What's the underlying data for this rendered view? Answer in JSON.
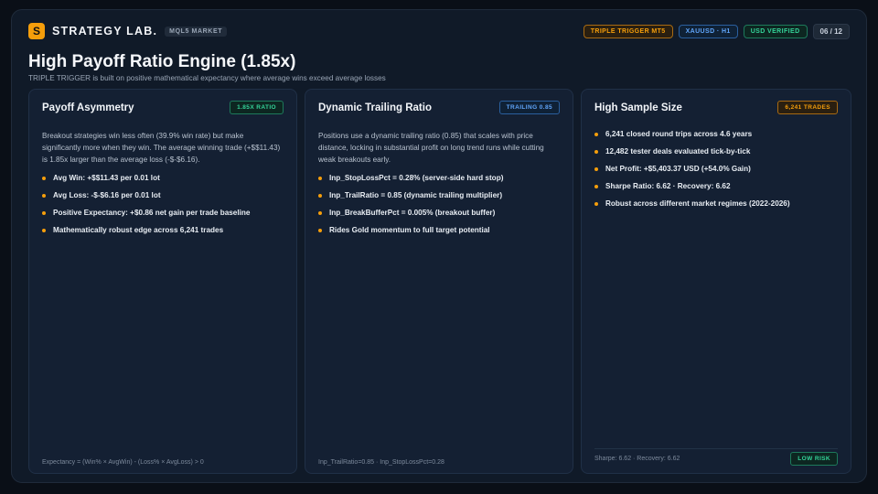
{
  "header": {
    "logo_letter": "S",
    "brand": "STRATEGY LAB.",
    "brand_tag": "MQL5 MARKET",
    "pills": [
      "TRIPLE TRIGGER MT5",
      "XAUUSD · H1",
      "USD VERIFIED"
    ],
    "pager": "06 / 12"
  },
  "page": {
    "title": "High Payoff Ratio Engine (1.85x)",
    "subtitle": "TRIPLE TRIGGER is built on positive mathematical expectancy where average wins exceed average losses"
  },
  "cards": [
    {
      "title": "Payoff Asymmetry",
      "badge": "1.85X RATIO",
      "desc": "Breakout strategies win less often (39.9% win rate) but make significantly more when they win. The average winning trade (+$$11.43) is 1.85x larger than the average loss (-$-$6.16).",
      "bullets": [
        "Avg Win: +$$11.43 per 0.01 lot",
        "Avg Loss: -$-$6.16 per 0.01 lot",
        "Positive Expectancy: +$0.86 net gain per trade baseline",
        "Mathematically robust edge across 6,241 trades"
      ],
      "footer": "Expectancy = (Win% × AvgWin) - (Loss% × AvgLoss) > 0"
    },
    {
      "title": "Dynamic Trailing Ratio",
      "badge": "TRAILING 0.85",
      "desc": "Positions use a dynamic trailing ratio (0.85) that scales with price distance, locking in substantial profit on long trend runs while cutting weak breakouts early.",
      "bullets": [
        "Inp_StopLossPct = 0.28% (server-side hard stop)",
        "Inp_TrailRatio = 0.85 (dynamic trailing multiplier)",
        "Inp_BreakBufferPct = 0.005% (breakout buffer)",
        "Rides Gold momentum to full target potential"
      ],
      "footer": "Inp_TrailRatio=0.85 · Inp_StopLossPct=0.28"
    },
    {
      "title": "High Sample Size",
      "badge": "6,241 TRADES",
      "bullets": [
        "6,241 closed round trips across 4.6 years",
        "12,482 tester deals evaluated tick-by-tick",
        "Net Profit: +$5,403.37 USD (+54.0% Gain)",
        "Sharpe Ratio: 6.62 · Recovery: 6.62",
        "Robust across different market regimes (2022-2026)"
      ],
      "footer": "Sharpe: 6.62 · Recovery: 6.62",
      "risk": "LOW RISK"
    }
  ],
  "colors": {
    "accent": "#f59e0b",
    "green": "#34d399",
    "blue": "#60a5fa"
  }
}
